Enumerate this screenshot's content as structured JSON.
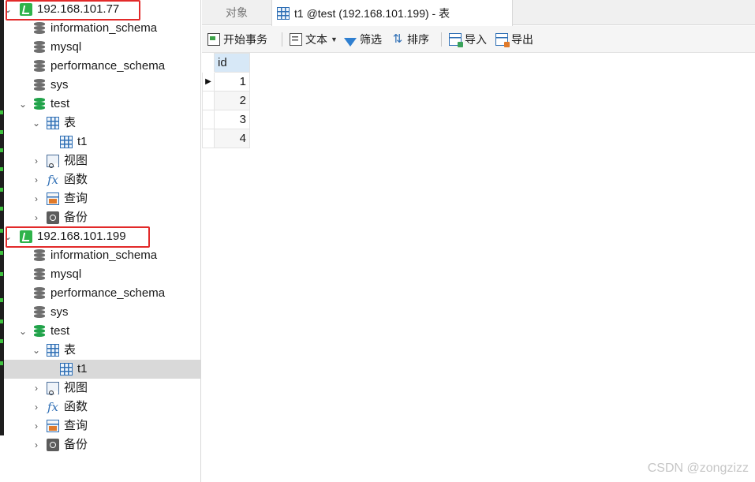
{
  "connections": [
    {
      "host": "192.168.101.77",
      "databases": [
        "information_schema",
        "mysql",
        "performance_schema",
        "sys"
      ],
      "active_database": "test",
      "groups": {
        "tables": "表",
        "views": "视图",
        "functions": "函数",
        "queries": "查询",
        "backups": "备份"
      },
      "tables": [
        "t1"
      ]
    },
    {
      "host": "192.168.101.199",
      "databases": [
        "information_schema",
        "mysql",
        "performance_schema",
        "sys"
      ],
      "active_database": "test",
      "groups": {
        "tables": "表",
        "views": "视图",
        "functions": "函数",
        "queries": "查询",
        "backups": "备份"
      },
      "tables": [
        "t1"
      ]
    }
  ],
  "tabs": {
    "objects": "对象",
    "table": "t1 @test (192.168.101.199) - 表"
  },
  "toolbar": {
    "begin_transaction": "开始事务",
    "text": "文本",
    "filter": "筛选",
    "sort": "排序",
    "import": "导入",
    "export": "导出"
  },
  "grid": {
    "column": "id",
    "rows": [
      "1",
      "2",
      "3",
      "4"
    ]
  },
  "watermark": "CSDN @zongzizz",
  "icons": {
    "connection": "connection-icon",
    "database": "database-icon",
    "table": "table-icon",
    "view": "view-icon",
    "function": "function-icon",
    "query": "query-icon",
    "backup": "backup-icon"
  },
  "colors": {
    "highlight_box": "#e22a2a",
    "connection_icon": "#2fb34a",
    "active_db_icon": "#21a34a",
    "column_header": "#d7e8f7",
    "selected_row": "#d9d9d9"
  }
}
